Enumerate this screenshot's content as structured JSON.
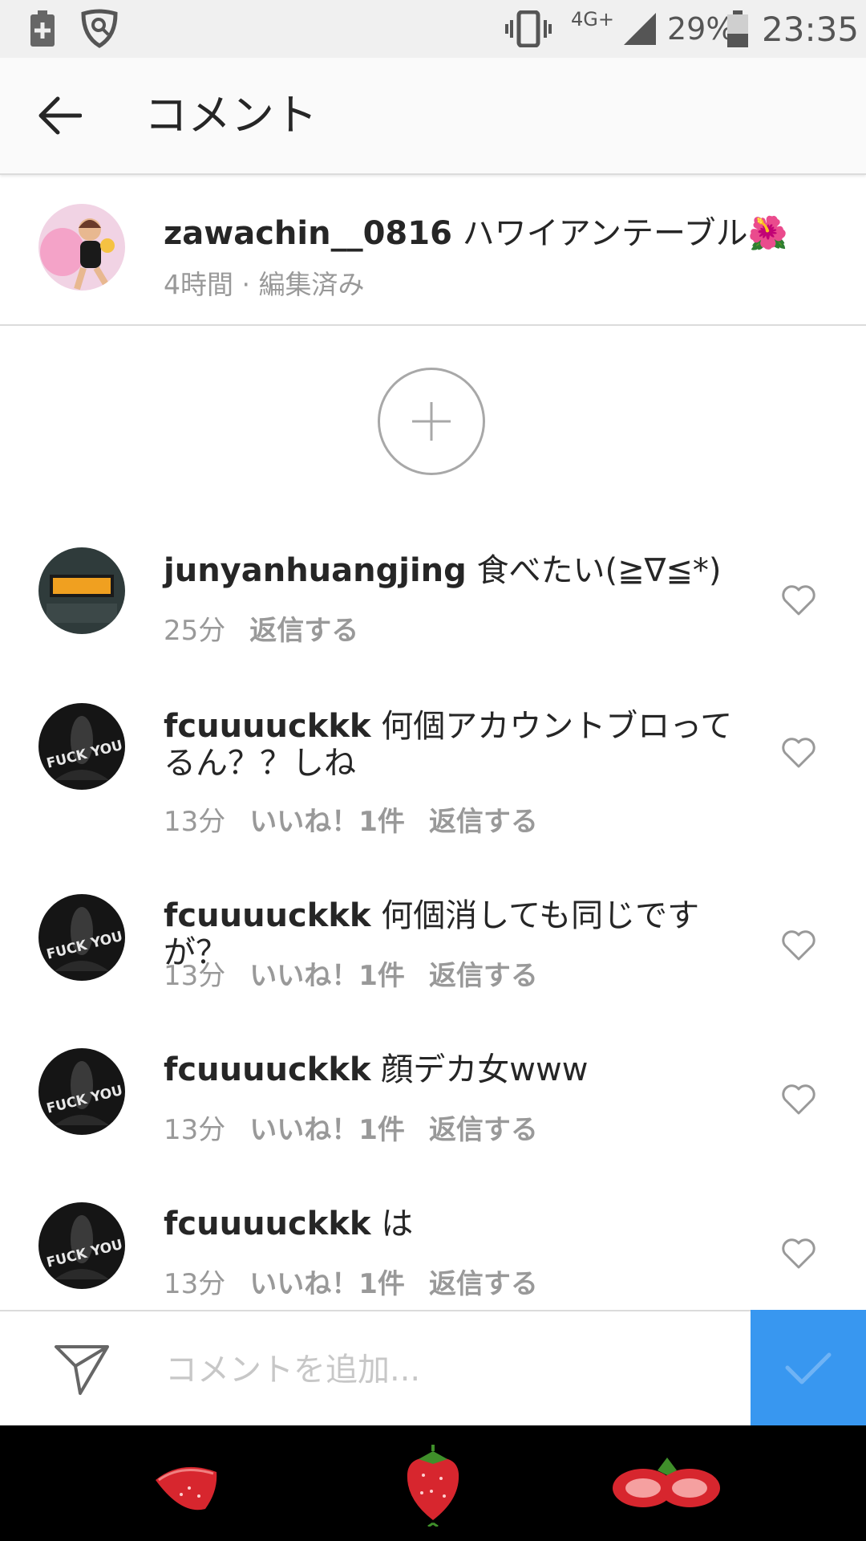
{
  "status_bar": {
    "network": "4G+",
    "battery_percent": "29%",
    "time": "23:35"
  },
  "toolbar": {
    "title": "コメント",
    "back_icon": "arrow-left-icon"
  },
  "caption": {
    "username": "zawachin__0816",
    "text": "ハワイアンテーブル🌺",
    "meta": "4時間 · 編集済み"
  },
  "load_more_icon": "plus-icon",
  "comments": [
    {
      "username": "junyanhuangjing",
      "text": "食べたい(≧∇≦*)",
      "time": "25分",
      "likes": "",
      "reply": "返信する"
    },
    {
      "username": "fcuuuuckkk",
      "text": "何個アカウントブロってるん？？しね",
      "time": "13分",
      "likes": "いいね！1件",
      "reply": "返信する"
    },
    {
      "username": "fcuuuuckkk",
      "text": "何個消しても同じですが？",
      "time": "13分",
      "likes": "いいね！1件",
      "reply": "返信する"
    },
    {
      "username": "fcuuuuckkk",
      "text": "顔デカ女www",
      "time": "13分",
      "likes": "いいね！1件",
      "reply": "返信する"
    },
    {
      "username": "fcuuuuckkk",
      "text": "は",
      "time": "13分",
      "likes": "いいね！1件",
      "reply": "返信する"
    }
  ],
  "input": {
    "placeholder": "コメントを追加...",
    "value": ""
  },
  "colors": {
    "accent": "#3897f0",
    "meta_text": "#999999",
    "nav_background": "#000000"
  },
  "nav_bar": {
    "items": [
      "strawberry-back-icon",
      "strawberry-home-icon",
      "strawberry-recents-icon"
    ]
  }
}
